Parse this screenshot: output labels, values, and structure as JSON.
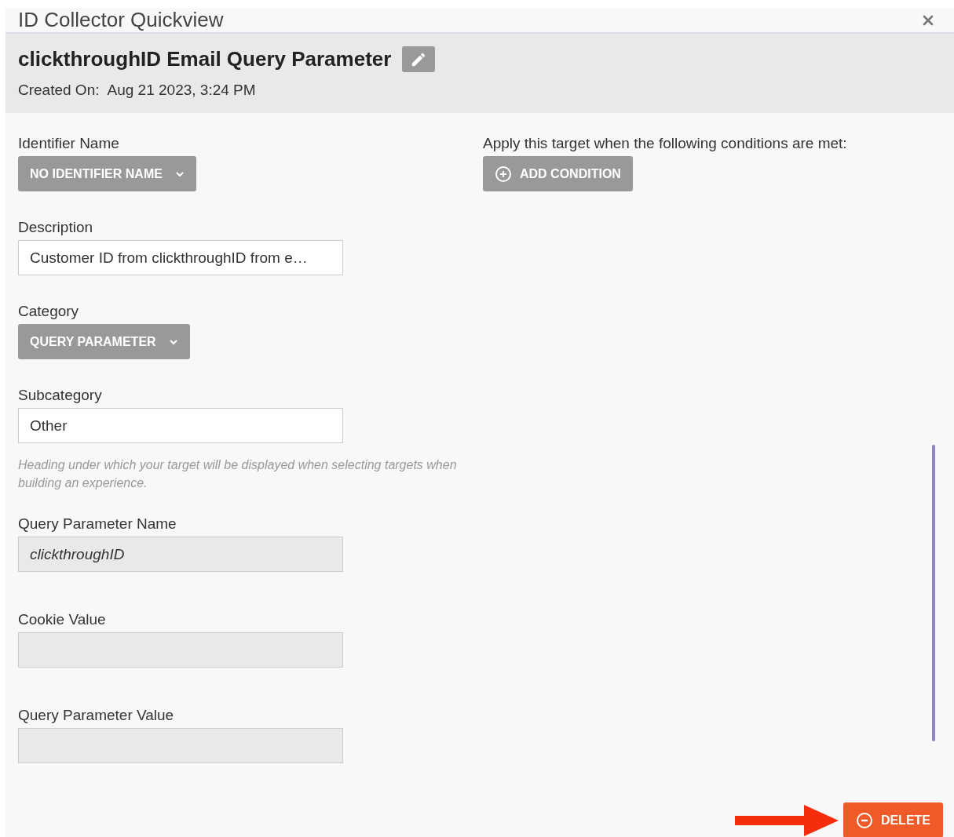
{
  "window": {
    "title": "ID Collector Quickview"
  },
  "header": {
    "title": "clickthroughID Email Query Parameter",
    "created_label": "Created On:",
    "created_value": "Aug 21 2023, 3:24 PM"
  },
  "fields": [
    {
      "label": "Identifier Name",
      "kind": "dropdown",
      "value": "NO IDENTIFIER NAME"
    },
    {
      "label": "Description",
      "kind": "text",
      "value": "Customer ID from clickthroughID from e…"
    },
    {
      "label": "Category",
      "kind": "dropdown",
      "value": "QUERY PARAMETER"
    },
    {
      "label": "Subcategory",
      "kind": "text",
      "value": "Other",
      "hint": "Heading under which your target will be displayed when selecting targets when building an experience."
    },
    {
      "label": "Query Parameter Name",
      "kind": "readonly",
      "value": "clickthroughID"
    },
    {
      "label": "Cookie Value",
      "kind": "readonly"
    },
    {
      "label": "Query Parameter Value",
      "kind": "readonly"
    }
  ],
  "conditions": {
    "label": "Apply this target when the following conditions are met:",
    "button": "ADD CONDITION"
  },
  "footer": {
    "button": "DELETE"
  }
}
